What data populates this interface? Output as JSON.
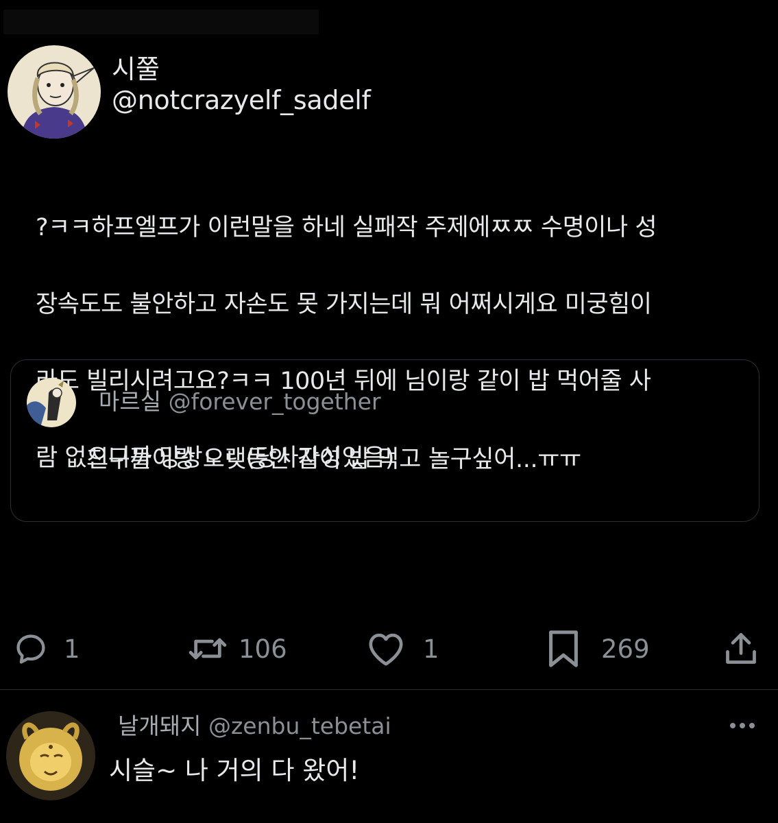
{
  "tweet": {
    "author_name": "시쭐",
    "author_handle": "@notcrazyelf_sadelf",
    "text_lines": [
      "?ㅋㅋ하프엘프가 이런말을 하네 실패작 주제에ㅉㅉ 수명이나 성",
      "장속도도 불안하고 자손도 못 가지는데 뭐 어쩌시게요 미궁힘이",
      "라도 빌리시려고요?ㅋㅋ 100년 뒤에 님이랑 같이 밥 먹어줄 사",
      "람 없으니까 망상ㄴㄴ(당사자성있음)"
    ]
  },
  "quote": {
    "name": "마르실",
    "handle": "@forever_together",
    "text": "친구들이랑 오랫동안 같이 밥 먹고 놀구싶어...ㅠㅠ"
  },
  "actions": {
    "reply_count": "1",
    "retweet_count": "106",
    "like_count": "1",
    "bookmark_count": "269"
  },
  "reply": {
    "name": "날개돼지",
    "handle": "@zenbu_tebetai",
    "text": "시슬~ 나 거의 다 왔어!"
  },
  "icons": {
    "reply": "speech-bubble-icon",
    "retweet": "retweet-arrows-icon",
    "like": "heart-icon",
    "bookmark": "bookmark-icon",
    "share": "share-upload-icon",
    "more": "more-dots-icon"
  },
  "colors": {
    "background": "#000000",
    "text": "#e7e9ea",
    "muted": "#8b9096",
    "border": "#2c2f33"
  }
}
